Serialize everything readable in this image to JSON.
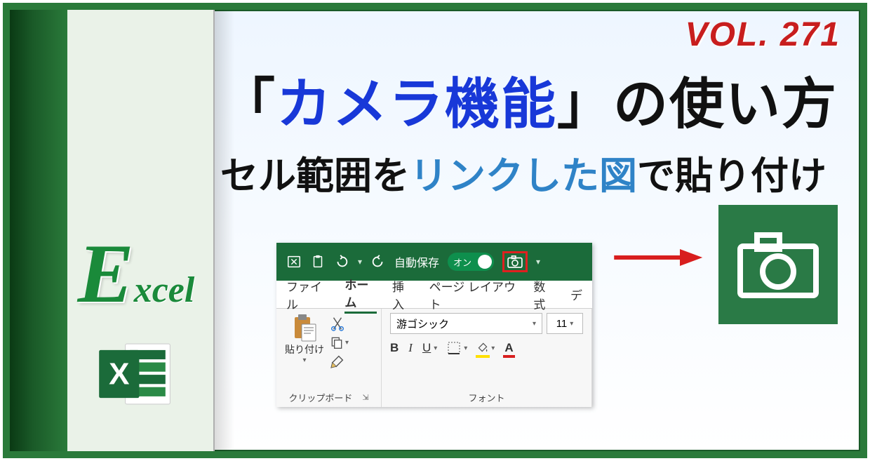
{
  "volume": "VOL. 271",
  "headline": {
    "open_quote": "「",
    "feature_name": "カメラ機能",
    "close_quote": "」",
    "suffix": "の使い方",
    "sub_prefix": "セル範囲を",
    "sub_highlight": "リンクした図",
    "sub_suffix": "で貼り付け"
  },
  "brand": {
    "E": "E",
    "xcel": "xcel"
  },
  "qat": {
    "autosave_label": "自動保存",
    "toggle_on": "オン",
    "customize": "▾"
  },
  "tabs": {
    "file": "ファイル",
    "home": "ホーム",
    "insert": "挿入",
    "page_layout": "ページ レイアウト",
    "formulas": "数式",
    "data_cut": "デ"
  },
  "clipboard": {
    "paste_label": "貼り付け",
    "group_label": "クリップボード"
  },
  "font": {
    "font_name": "游ゴシック",
    "font_size": "11",
    "group_label": "フォント",
    "B": "B",
    "I": "I",
    "U": "U",
    "fill_A": "A",
    "font_A": "A"
  },
  "launcher_glyph": "⇲"
}
